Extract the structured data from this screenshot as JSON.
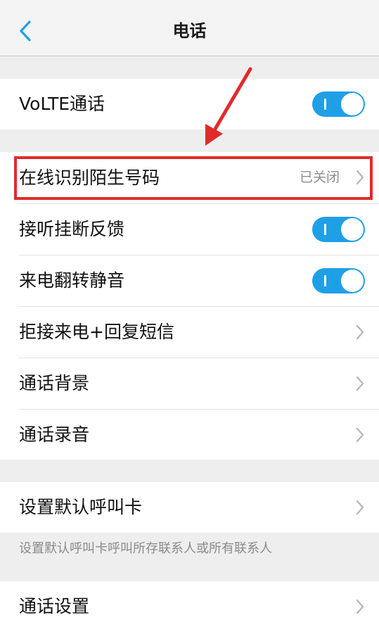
{
  "header": {
    "title": "电话",
    "back_icon": "chevron-left-icon"
  },
  "colors": {
    "accent": "#1fa0e6",
    "highlight": "#e02b2b",
    "background": "#eeeeee"
  },
  "rows": {
    "volte": {
      "label": "VoLTE通话",
      "toggle_on": true
    },
    "unknown_number": {
      "label": "在线识别陌生号码",
      "status": "已关闭"
    },
    "answer_hangup_feedback": {
      "label": "接听挂断反馈",
      "toggle_on": true
    },
    "flip_to_mute": {
      "label": "来电翻转静音",
      "toggle_on": true
    },
    "reject_sms": {
      "label": "拒接来电+回复短信"
    },
    "call_background": {
      "label": "通话背景"
    },
    "call_recording": {
      "label": "通话录音"
    },
    "default_sim": {
      "label": "设置默认呼叫卡"
    },
    "call_settings": {
      "label": "通话设置"
    }
  },
  "hint": {
    "default_sim_description": "设置默认呼叫卡呼叫所存联系人或所有联系人"
  }
}
